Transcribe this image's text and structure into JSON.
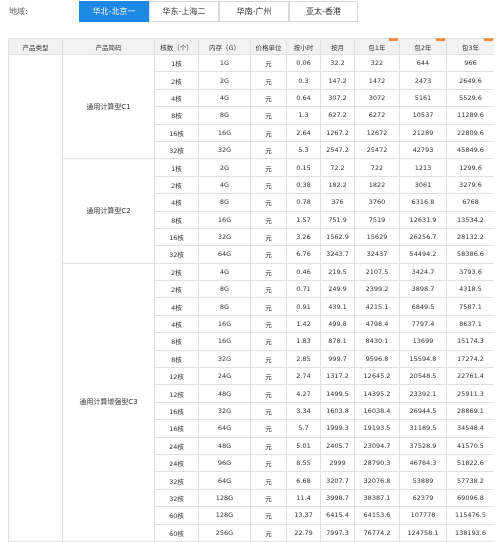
{
  "region": {
    "label": "地域:",
    "tabs": [
      {
        "label": "华北-北京一",
        "active": true
      },
      {
        "label": "华东-上海二",
        "active": false
      },
      {
        "label": "华南-广州",
        "active": false
      },
      {
        "label": "亚太-香港",
        "active": false
      }
    ]
  },
  "table": {
    "headers": [
      "产品类型",
      "产品简码",
      "核数（个）",
      "内存（G）",
      "价格单位",
      "按小时",
      "按月",
      "包1年",
      "包2年",
      "包3年"
    ],
    "badge_text": "惠",
    "groups": [
      {
        "name": "通用计算型C1",
        "rows": [
          [
            "1核",
            "1G",
            "元",
            "0.06",
            "32.2",
            "322",
            "644",
            "966"
          ],
          [
            "2核",
            "2G",
            "元",
            "0.3",
            "147.2",
            "1472",
            "2473",
            "2649.6"
          ],
          [
            "4核",
            "4G",
            "元",
            "0.64",
            "307.2",
            "3072",
            "5161",
            "5529.6"
          ],
          [
            "8核",
            "8G",
            "元",
            "1.3",
            "627.2",
            "6272",
            "10537",
            "11289.6"
          ],
          [
            "16核",
            "16G",
            "元",
            "2.64",
            "1267.2",
            "12672",
            "21289",
            "22809.6"
          ],
          [
            "32核",
            "32G",
            "元",
            "5.3",
            "2547.2",
            "25472",
            "42793",
            "45849.6"
          ]
        ]
      },
      {
        "name": "通用计算型C2",
        "rows": [
          [
            "1核",
            "2G",
            "元",
            "0.15",
            "72.2",
            "722",
            "1213",
            "1299.6"
          ],
          [
            "2核",
            "4G",
            "元",
            "0.38",
            "182.2",
            "1822",
            "3061",
            "3279.6"
          ],
          [
            "4核",
            "8G",
            "元",
            "0.78",
            "376",
            "3760",
            "6316.8",
            "6768"
          ],
          [
            "8核",
            "16G",
            "元",
            "1.57",
            "751.9",
            "7519",
            "12631.9",
            "13534.2"
          ],
          [
            "16核",
            "32G",
            "元",
            "3.26",
            "1562.9",
            "15629",
            "26256.7",
            "28132.2"
          ],
          [
            "32核",
            "64G",
            "元",
            "6.76",
            "3243.7",
            "32437",
            "54494.2",
            "58386.6"
          ]
        ]
      },
      {
        "name": "通用计算增强型C3",
        "rows": [
          [
            "2核",
            "4G",
            "元",
            "0.46",
            "219.5",
            "2107.5",
            "3424.7",
            "3793.6"
          ],
          [
            "2核",
            "8G",
            "元",
            "0.71",
            "249.9",
            "2399.2",
            "3898.7",
            "4318.5"
          ],
          [
            "4核",
            "8G",
            "元",
            "0.91",
            "439.1",
            "4215.1",
            "6849.5",
            "7587.1"
          ],
          [
            "4核",
            "16G",
            "元",
            "1.42",
            "499.8",
            "4798.4",
            "7797.4",
            "8637.1"
          ],
          [
            "8核",
            "16G",
            "元",
            "1.83",
            "878.1",
            "8430.1",
            "13699",
            "15174.3"
          ],
          [
            "8核",
            "32G",
            "元",
            "2.85",
            "999.7",
            "9596.8",
            "15594.8",
            "17274.2"
          ],
          [
            "12核",
            "24G",
            "元",
            "2.74",
            "1317.2",
            "12645.2",
            "20548.5",
            "22761.4"
          ],
          [
            "12核",
            "48G",
            "元",
            "4.27",
            "1499.5",
            "14395.2",
            "23392.1",
            "25911.3"
          ],
          [
            "16核",
            "32G",
            "元",
            "3.34",
            "1603.8",
            "16038.4",
            "26944.5",
            "28869.1"
          ],
          [
            "16核",
            "64G",
            "元",
            "5.7",
            "1999.3",
            "19193.5",
            "31189.5",
            "34548.4"
          ],
          [
            "24核",
            "48G",
            "元",
            "5.01",
            "2405.7",
            "23094.7",
            "37528.9",
            "41570.5"
          ],
          [
            "24核",
            "96G",
            "元",
            "8.55",
            "2999",
            "28790.3",
            "46784.3",
            "51822.6"
          ],
          [
            "32核",
            "64G",
            "元",
            "6.68",
            "3207.7",
            "32076.8",
            "53889",
            "57738.2"
          ],
          [
            "32核",
            "128G",
            "元",
            "11.4",
            "3998.7",
            "38387.1",
            "62379",
            "69096.8"
          ],
          [
            "60核",
            "128G",
            "元",
            "13.37",
            "6415.4",
            "64153.6",
            "107778",
            "115476.5"
          ],
          [
            "60核",
            "256G",
            "元",
            "22.79",
            "7997.3",
            "76774.2",
            "124758.1",
            "138193.6"
          ]
        ]
      }
    ]
  },
  "colors": {
    "accent": "#1e88e5",
    "header_bg": "#f2f2f2",
    "border": "#e0e0e0",
    "badge": "#f0883a"
  }
}
